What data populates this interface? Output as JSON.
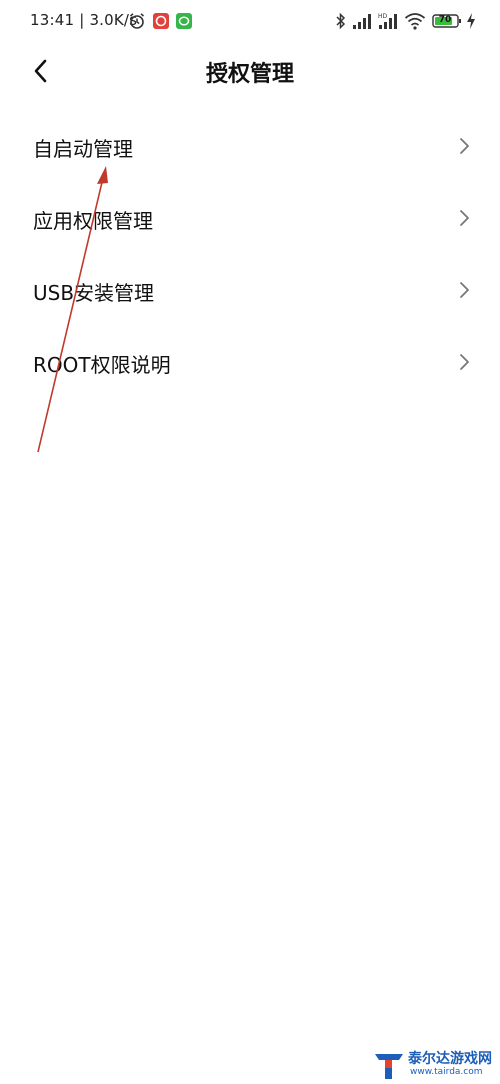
{
  "status_bar": {
    "time": "13:41",
    "speed": "3.0K/s",
    "battery": "70"
  },
  "header": {
    "title": "授权管理"
  },
  "menu": {
    "items": [
      {
        "label": "自启动管理"
      },
      {
        "label": "应用权限管理"
      },
      {
        "label": "USB安装管理"
      },
      {
        "label": "ROOT权限说明"
      }
    ]
  },
  "watermark": {
    "title": "泰尔达游戏网",
    "url": "www.tairda.com"
  },
  "colors": {
    "annotation_arrow": "#c0392b",
    "watermark": "#1d5fb8"
  }
}
